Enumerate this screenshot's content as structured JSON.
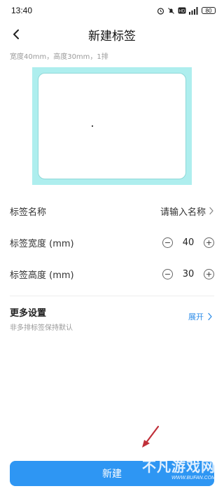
{
  "status_bar": {
    "time": "13:40",
    "battery": "80"
  },
  "header": {
    "title": "新建标签"
  },
  "label_spec": "宽度40mm，高度30mm，1排",
  "form": {
    "name": {
      "label": "标签名称",
      "placeholder": "请输入名称"
    },
    "width": {
      "label": "标签宽度 (mm)",
      "value": "40",
      "minus": "−",
      "plus": "+"
    },
    "height": {
      "label": "标签高度 (mm)",
      "value": "30",
      "minus": "−",
      "plus": "+"
    }
  },
  "more_settings": {
    "title": "更多设置",
    "subtitle": "非多排标签保持默认",
    "expand_label": "展开"
  },
  "create_button": "新建",
  "watermark": {
    "main": "不凡游戏网",
    "sub": "WWW.BUFAN.COM"
  },
  "colors": {
    "accent": "#2e96f3",
    "preview_border": "#aeeeee",
    "link": "#2d8ce8"
  },
  "icons": {
    "back": "chevron-left-icon",
    "name_arrow": "chevron-right-icon",
    "expand_arrow": "chevron-right-icon"
  }
}
